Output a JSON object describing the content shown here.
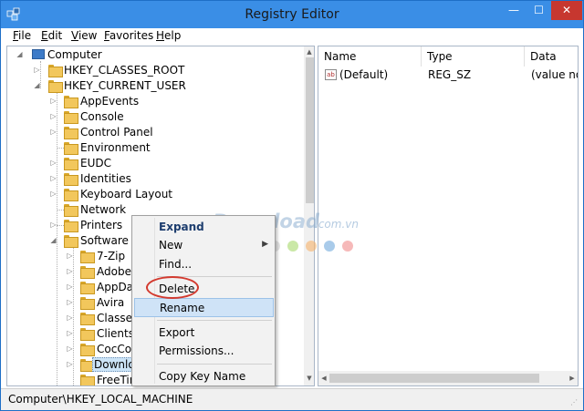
{
  "window": {
    "title": "Registry Editor",
    "controls": {
      "minimize": "—",
      "maximize": "☐",
      "close": "✕"
    }
  },
  "menu": [
    "File",
    "Edit",
    "View",
    "Favorites",
    "Help"
  ],
  "tree": {
    "root": "Computer",
    "items": [
      {
        "label": "HKEY_CLASSES_ROOT"
      },
      {
        "label": "HKEY_CURRENT_USER"
      },
      {
        "label": "AppEvents"
      },
      {
        "label": "Console"
      },
      {
        "label": "Control Panel"
      },
      {
        "label": "Environment"
      },
      {
        "label": "EUDC"
      },
      {
        "label": "Identities"
      },
      {
        "label": "Keyboard Layout"
      },
      {
        "label": "Network"
      },
      {
        "label": "Printers"
      },
      {
        "label": "Software"
      },
      {
        "label": "7-Zip"
      },
      {
        "label": "Adobe"
      },
      {
        "label": "AppDat"
      },
      {
        "label": "Avira"
      },
      {
        "label": "Classes"
      },
      {
        "label": "Clients"
      },
      {
        "label": "CocCoc"
      },
      {
        "label": "Downloa"
      },
      {
        "label": "FreeTim"
      }
    ]
  },
  "list": {
    "columns": [
      "Name",
      "Type",
      "Data"
    ],
    "rows": [
      {
        "name": "(Default)",
        "type": "REG_SZ",
        "data": "(value not"
      }
    ],
    "value_icon": "ab"
  },
  "context_menu": {
    "items": [
      "Expand",
      "New",
      "Find...",
      "Delete",
      "Rename",
      "Export",
      "Permissions...",
      "Copy Key Name"
    ],
    "highlighted": "Delete",
    "hovered": "Rename"
  },
  "watermark": {
    "text": "Download",
    "suffix": ".com.vn"
  },
  "status": {
    "path": "Computer\\HKEY_LOCAL_MACHINE"
  },
  "colors": {
    "titlebar": "#3a8ee6",
    "close_button": "#c7372f",
    "selection": "#cce4f7",
    "highlight_ring": "#d33a2f",
    "watermark_dots": [
      "#7fb3e3",
      "#a6d96a",
      "#f6b26b",
      "#f4c28f",
      "#6fa8dc",
      "#f08a8a"
    ]
  }
}
